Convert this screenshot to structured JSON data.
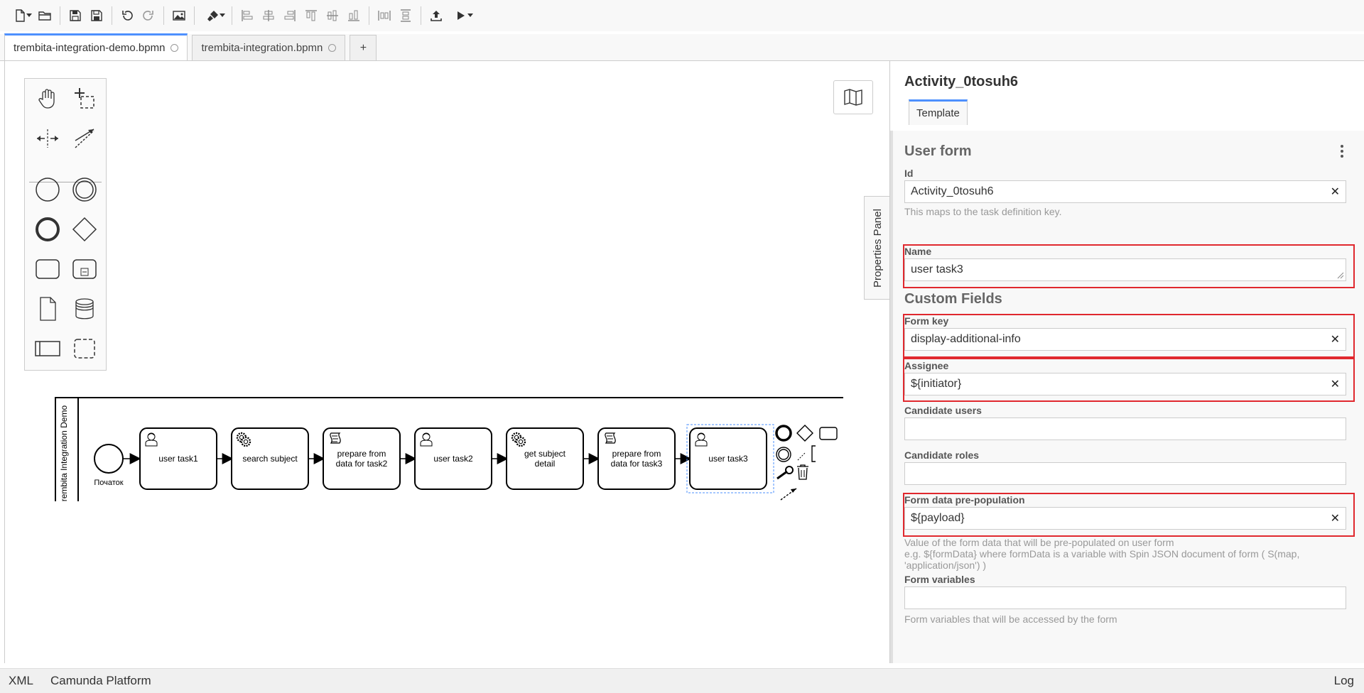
{
  "tabs": [
    {
      "label": "trembita-integration-demo.bpmn",
      "active": true
    },
    {
      "label": "trembita-integration.bpmn",
      "active": false
    }
  ],
  "new_tab_label": "+",
  "pool": {
    "label": "Trembita Integration Demo"
  },
  "start_event": {
    "label": "Початок"
  },
  "tasks": [
    {
      "type": "user-task",
      "lines": [
        "user task1"
      ]
    },
    {
      "type": "service-task",
      "lines": [
        "search subject"
      ]
    },
    {
      "type": "script-task",
      "lines": [
        "prepare from",
        "data for task2"
      ]
    },
    {
      "type": "user-task",
      "lines": [
        "user task2"
      ]
    },
    {
      "type": "service-task",
      "lines": [
        "get subject",
        "detail"
      ]
    },
    {
      "type": "script-task",
      "lines": [
        "prepare from",
        "data for task3"
      ]
    },
    {
      "type": "user-task",
      "lines": [
        "user task3"
      ],
      "selected": true
    }
  ],
  "properties_toggle": "Properties Panel",
  "panel": {
    "title": "Activity_0tosuh6",
    "tab": "Template",
    "group_user_form": "User form",
    "group_custom_fields": "Custom Fields",
    "fields": {
      "id": {
        "label": "Id",
        "value": "Activity_0tosuh6",
        "hint": "This maps to the task definition key."
      },
      "name": {
        "label": "Name",
        "value": "user task3"
      },
      "form_key": {
        "label": "Form key",
        "value": "display-additional-info"
      },
      "assignee": {
        "label": "Assignee",
        "value": "${initiator}"
      },
      "candidate_users": {
        "label": "Candidate users",
        "value": ""
      },
      "candidate_roles": {
        "label": "Candidate roles",
        "value": ""
      },
      "prepopulation": {
        "label": "Form data pre-population",
        "value": "${payload}",
        "hint_lines": [
          "Value of the form data that will be pre-populated on user form",
          "e.g. ${formData} where formData is a variable with Spin JSON document of form ( S(map,",
          "'application/json') )"
        ]
      },
      "form_variables": {
        "label": "Form variables",
        "value": "",
        "hint": "Form variables that will be accessed by the form"
      }
    }
  },
  "status": {
    "xml": "XML",
    "platform": "Camunda Platform",
    "log": "Log"
  },
  "colors": {
    "accent": "#4d90fe",
    "highlight": "#e0282e",
    "selection": "#4d90fe"
  }
}
